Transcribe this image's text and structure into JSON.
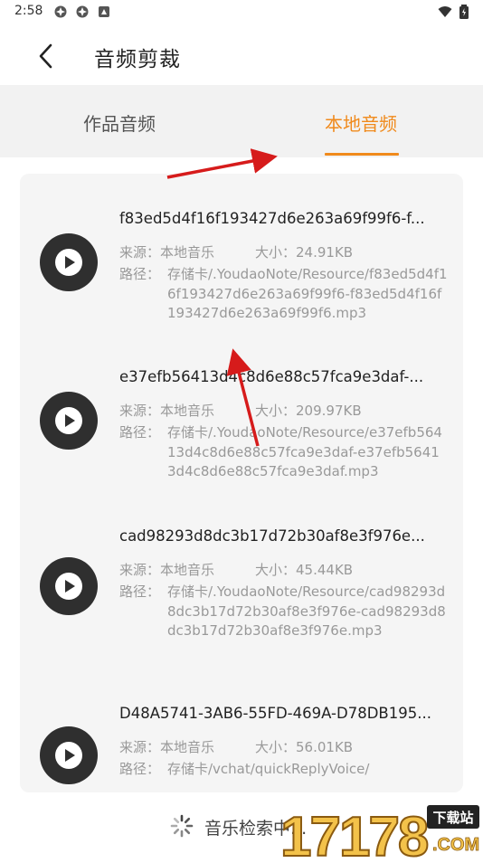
{
  "status_bar": {
    "time": "2:58"
  },
  "header": {
    "title": "音频剪裁"
  },
  "tabs": [
    {
      "label": "作品音频",
      "active": false
    },
    {
      "label": "本地音频",
      "active": true
    }
  ],
  "colors": {
    "accent": "#f08a1c",
    "annotation_arrow": "#d61b1b"
  },
  "audio_items": [
    {
      "filename": "f83ed5d4f16f193427d6e263a69f99f6-f...",
      "source_label": "来源：本地音乐",
      "size_label": "大小：24.91KB",
      "path_label": "路径：",
      "path_value": "存储卡/.YoudaoNote/Resource/f83ed5d4f16f193427d6e263a69f99f6-f83ed5d4f16f193427d6e263a69f99f6.mp3"
    },
    {
      "filename": "e37efb56413d4c8d6e88c57fca9e3daf-...",
      "source_label": "来源：本地音乐",
      "size_label": "大小：209.97KB",
      "path_label": "路径：",
      "path_value": "存储卡/.YoudaoNote/Resource/e37efb56413d4c8d6e88c57fca9e3daf-e37efb56413d4c8d6e88c57fca9e3daf.mp3"
    },
    {
      "filename": "cad98293d8dc3b17d72b30af8e3f976e...",
      "source_label": "来源：本地音乐",
      "size_label": "大小：45.44KB",
      "path_label": "路径：",
      "path_value": "存储卡/.YoudaoNote/Resource/cad98293d8dc3b17d72b30af8e3f976e-cad98293d8dc3b17d72b30af8e3f976e.mp3"
    },
    {
      "filename": "D48A5741-3AB6-55FD-469A-D78DB195...",
      "source_label": "来源：本地音乐",
      "size_label": "大小：56.01KB",
      "path_label": "路径：",
      "path_value": "存储卡/vchat/quickReplyVoice/"
    }
  ],
  "loading": {
    "text": "音乐检索中..."
  },
  "watermark": {
    "text": "17178",
    "badge": "下载站",
    "suffix": ".COM"
  }
}
